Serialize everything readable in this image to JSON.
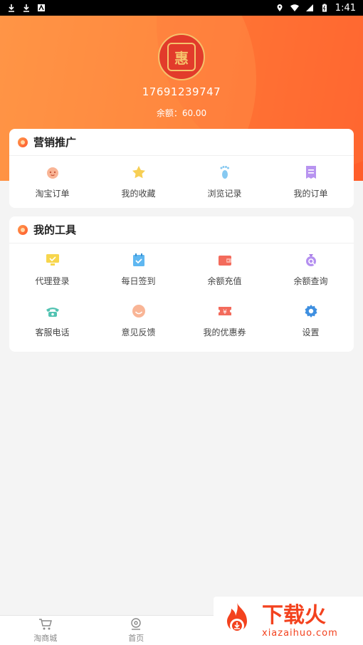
{
  "status_bar": {
    "time": "1:41"
  },
  "header": {
    "avatar_char": "惠",
    "phone": "17691239747",
    "balance": "余额：60.00"
  },
  "marketing": {
    "title": "营销推广",
    "items": [
      {
        "label": "淘宝订单",
        "icon": "peach-face-icon",
        "color": "#f7a07a"
      },
      {
        "label": "我的收藏",
        "icon": "star-icon",
        "color": "#f5cb4c"
      },
      {
        "label": "浏览记录",
        "icon": "footprint-icon",
        "color": "#7ec3ef"
      },
      {
        "label": "我的订单",
        "icon": "receipt-icon",
        "color": "#b48ff0"
      }
    ]
  },
  "tools": {
    "title": "我的工具",
    "items": [
      {
        "label": "代理登录",
        "icon": "monitor-icon",
        "color": "#f5d247"
      },
      {
        "label": "每日签到",
        "icon": "calendar-check-icon",
        "color": "#5ab4f0"
      },
      {
        "label": "余额充值",
        "icon": "wallet-icon",
        "color": "#f46a5a"
      },
      {
        "label": "余额查询",
        "icon": "money-bag-search-icon",
        "color": "#a77be6"
      },
      {
        "label": "客服电话",
        "icon": "telephone-icon",
        "color": "#4fc1b0"
      },
      {
        "label": "意见反馈",
        "icon": "smile-face-icon",
        "color": "#f7a07a"
      },
      {
        "label": "我的优惠券",
        "icon": "coupon-icon",
        "color": "#f46a5a"
      },
      {
        "label": "设置",
        "icon": "gear-icon",
        "color": "#3b8de0"
      }
    ]
  },
  "bottom_nav": [
    {
      "label": "淘商城",
      "icon": "cart-icon"
    },
    {
      "label": "首页",
      "icon": "location-pin-icon"
    },
    {
      "label": "",
      "icon": ""
    },
    {
      "label": "",
      "icon": ""
    }
  ],
  "watermark": {
    "big": "下载火",
    "small": "xiazaihuo.com"
  }
}
